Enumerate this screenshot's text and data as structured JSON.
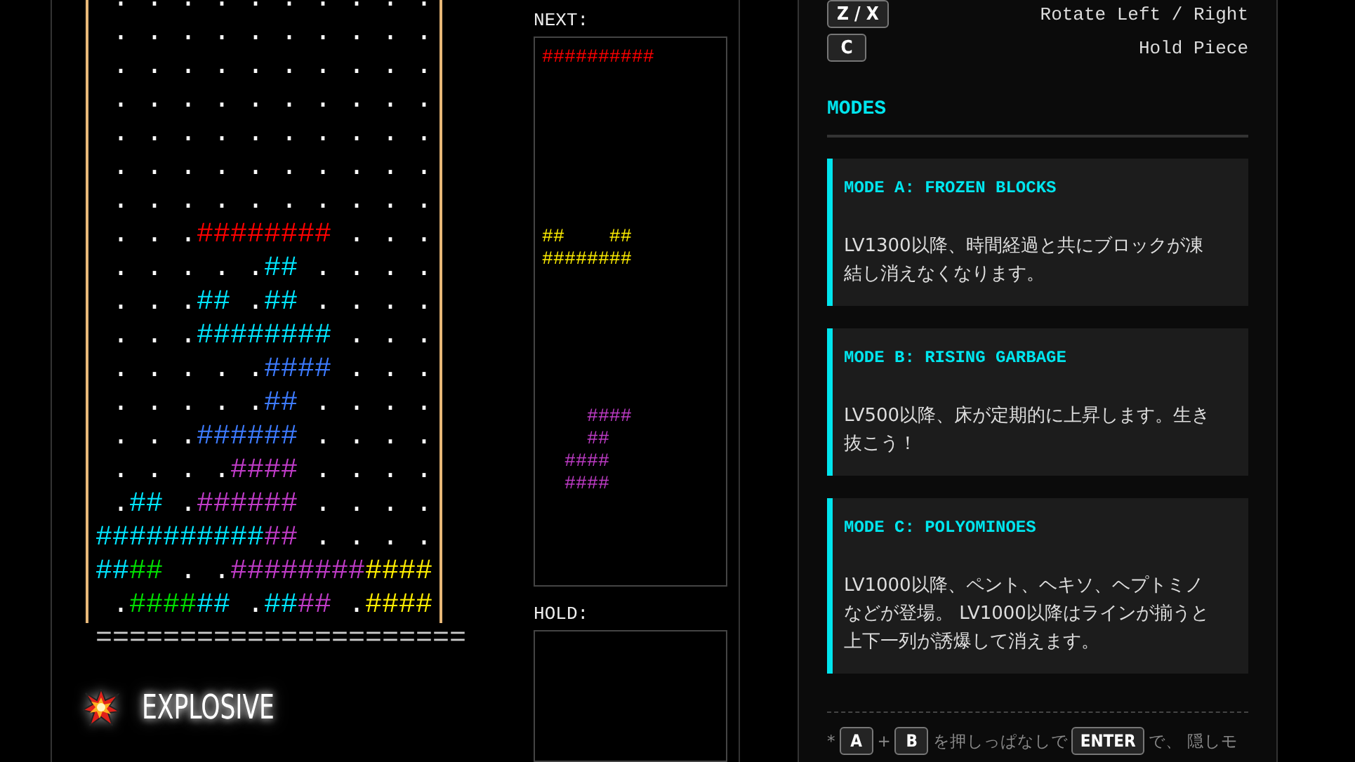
{
  "board": {
    "rows": [
      [
        {
          "kind": "empty",
          "text": " ."
        },
        {
          "kind": "empty",
          "text": " ."
        },
        {
          "kind": "empty",
          "text": " ."
        },
        {
          "kind": "empty",
          "text": " ."
        },
        {
          "kind": "empty",
          "text": " ."
        },
        {
          "kind": "empty",
          "text": " ."
        },
        {
          "kind": "empty",
          "text": " ."
        },
        {
          "kind": "empty",
          "text": " ."
        },
        {
          "kind": "empty",
          "text": " ."
        },
        {
          "kind": "empty",
          "text": " ."
        }
      ],
      [
        {
          "kind": "empty",
          "text": " ."
        },
        {
          "kind": "empty",
          "text": " ."
        },
        {
          "kind": "empty",
          "text": " ."
        },
        {
          "kind": "empty",
          "text": " ."
        },
        {
          "kind": "empty",
          "text": " ."
        },
        {
          "kind": "empty",
          "text": " ."
        },
        {
          "kind": "empty",
          "text": " ."
        },
        {
          "kind": "empty",
          "text": " ."
        },
        {
          "kind": "empty",
          "text": " ."
        },
        {
          "kind": "empty",
          "text": " ."
        }
      ],
      [
        {
          "kind": "empty",
          "text": " ."
        },
        {
          "kind": "empty",
          "text": " ."
        },
        {
          "kind": "empty",
          "text": " ."
        },
        {
          "kind": "empty",
          "text": " ."
        },
        {
          "kind": "empty",
          "text": " ."
        },
        {
          "kind": "empty",
          "text": " ."
        },
        {
          "kind": "empty",
          "text": " ."
        },
        {
          "kind": "empty",
          "text": " ."
        },
        {
          "kind": "empty",
          "text": " ."
        },
        {
          "kind": "empty",
          "text": " ."
        }
      ],
      [
        {
          "kind": "empty",
          "text": " ."
        },
        {
          "kind": "empty",
          "text": " ."
        },
        {
          "kind": "empty",
          "text": " ."
        },
        {
          "kind": "empty",
          "text": " ."
        },
        {
          "kind": "empty",
          "text": " ."
        },
        {
          "kind": "empty",
          "text": " ."
        },
        {
          "kind": "empty",
          "text": " ."
        },
        {
          "kind": "empty",
          "text": " ."
        },
        {
          "kind": "empty",
          "text": " ."
        },
        {
          "kind": "empty",
          "text": " ."
        }
      ],
      [
        {
          "kind": "empty",
          "text": " ."
        },
        {
          "kind": "empty",
          "text": " ."
        },
        {
          "kind": "empty",
          "text": " ."
        },
        {
          "kind": "empty",
          "text": " ."
        },
        {
          "kind": "empty",
          "text": " ."
        },
        {
          "kind": "empty",
          "text": " ."
        },
        {
          "kind": "empty",
          "text": " ."
        },
        {
          "kind": "empty",
          "text": " ."
        },
        {
          "kind": "empty",
          "text": " ."
        },
        {
          "kind": "empty",
          "text": " ."
        }
      ],
      [
        {
          "kind": "empty",
          "text": " ."
        },
        {
          "kind": "empty",
          "text": " ."
        },
        {
          "kind": "empty",
          "text": " ."
        },
        {
          "kind": "empty",
          "text": " ."
        },
        {
          "kind": "empty",
          "text": " ."
        },
        {
          "kind": "empty",
          "text": " ."
        },
        {
          "kind": "empty",
          "text": " ."
        },
        {
          "kind": "empty",
          "text": " ."
        },
        {
          "kind": "empty",
          "text": " ."
        },
        {
          "kind": "empty",
          "text": " ."
        }
      ],
      [
        {
          "kind": "empty",
          "text": " ."
        },
        {
          "kind": "empty",
          "text": " ."
        },
        {
          "kind": "empty",
          "text": " ."
        },
        {
          "kind": "empty",
          "text": " ."
        },
        {
          "kind": "empty",
          "text": " ."
        },
        {
          "kind": "empty",
          "text": " ."
        },
        {
          "kind": "empty",
          "text": " ."
        },
        {
          "kind": "empty",
          "text": " ."
        },
        {
          "kind": "empty",
          "text": " ."
        },
        {
          "kind": "empty",
          "text": " ."
        }
      ],
      [
        {
          "kind": "empty",
          "text": " ."
        },
        {
          "kind": "empty",
          "text": " ."
        },
        {
          "kind": "empty",
          "text": " ."
        },
        {
          "kind": "block",
          "text": "##",
          "color": "#ff0000"
        },
        {
          "kind": "block",
          "text": "##",
          "color": "#ff0000"
        },
        {
          "kind": "block",
          "text": "##",
          "color": "#ff0000"
        },
        {
          "kind": "block",
          "text": "##",
          "color": "#ff0000"
        },
        {
          "kind": "empty",
          "text": " ."
        },
        {
          "kind": "empty",
          "text": " ."
        },
        {
          "kind": "empty",
          "text": " ."
        }
      ],
      [
        {
          "kind": "empty",
          "text": " ."
        },
        {
          "kind": "empty",
          "text": " ."
        },
        {
          "kind": "empty",
          "text": " ."
        },
        {
          "kind": "empty",
          "text": " ."
        },
        {
          "kind": "empty",
          "text": " ."
        },
        {
          "kind": "block",
          "text": "##",
          "color": "#00e5ff"
        },
        {
          "kind": "empty",
          "text": " ."
        },
        {
          "kind": "empty",
          "text": " ."
        },
        {
          "kind": "empty",
          "text": " ."
        },
        {
          "kind": "empty",
          "text": " ."
        }
      ],
      [
        {
          "kind": "empty",
          "text": " ."
        },
        {
          "kind": "empty",
          "text": " ."
        },
        {
          "kind": "empty",
          "text": " ."
        },
        {
          "kind": "block",
          "text": "##",
          "color": "#00e5ff"
        },
        {
          "kind": "empty",
          "text": " ."
        },
        {
          "kind": "block",
          "text": "##",
          "color": "#00e5ff"
        },
        {
          "kind": "empty",
          "text": " ."
        },
        {
          "kind": "empty",
          "text": " ."
        },
        {
          "kind": "empty",
          "text": " ."
        },
        {
          "kind": "empty",
          "text": " ."
        }
      ],
      [
        {
          "kind": "empty",
          "text": " ."
        },
        {
          "kind": "empty",
          "text": " ."
        },
        {
          "kind": "empty",
          "text": " ."
        },
        {
          "kind": "block",
          "text": "##",
          "color": "#00e5ff"
        },
        {
          "kind": "block",
          "text": "##",
          "color": "#00e5ff"
        },
        {
          "kind": "block",
          "text": "##",
          "color": "#00e5ff"
        },
        {
          "kind": "block",
          "text": "##",
          "color": "#00e5ff"
        },
        {
          "kind": "empty",
          "text": " ."
        },
        {
          "kind": "empty",
          "text": " ."
        },
        {
          "kind": "empty",
          "text": " ."
        }
      ],
      [
        {
          "kind": "empty",
          "text": " ."
        },
        {
          "kind": "empty",
          "text": " ."
        },
        {
          "kind": "empty",
          "text": " ."
        },
        {
          "kind": "empty",
          "text": " ."
        },
        {
          "kind": "empty",
          "text": " ."
        },
        {
          "kind": "block",
          "text": "##",
          "color": "#3d7bff"
        },
        {
          "kind": "block",
          "text": "##",
          "color": "#3d7bff"
        },
        {
          "kind": "empty",
          "text": " ."
        },
        {
          "kind": "empty",
          "text": " ."
        },
        {
          "kind": "empty",
          "text": " ."
        }
      ],
      [
        {
          "kind": "empty",
          "text": " ."
        },
        {
          "kind": "empty",
          "text": " ."
        },
        {
          "kind": "empty",
          "text": " ."
        },
        {
          "kind": "empty",
          "text": " ."
        },
        {
          "kind": "empty",
          "text": " ."
        },
        {
          "kind": "block",
          "text": "##",
          "color": "#3d7bff"
        },
        {
          "kind": "empty",
          "text": " ."
        },
        {
          "kind": "empty",
          "text": " ."
        },
        {
          "kind": "empty",
          "text": " ."
        },
        {
          "kind": "empty",
          "text": " ."
        }
      ],
      [
        {
          "kind": "empty",
          "text": " ."
        },
        {
          "kind": "empty",
          "text": " ."
        },
        {
          "kind": "empty",
          "text": " ."
        },
        {
          "kind": "block",
          "text": "##",
          "color": "#3d7bff"
        },
        {
          "kind": "block",
          "text": "##",
          "color": "#3d7bff"
        },
        {
          "kind": "block",
          "text": "##",
          "color": "#3d7bff"
        },
        {
          "kind": "empty",
          "text": " ."
        },
        {
          "kind": "empty",
          "text": " ."
        },
        {
          "kind": "empty",
          "text": " ."
        },
        {
          "kind": "empty",
          "text": " ."
        }
      ],
      [
        {
          "kind": "empty",
          "text": " ."
        },
        {
          "kind": "empty",
          "text": " ."
        },
        {
          "kind": "empty",
          "text": " ."
        },
        {
          "kind": "empty",
          "text": " ."
        },
        {
          "kind": "block",
          "text": "##",
          "color": "#c03cc8"
        },
        {
          "kind": "block",
          "text": "##",
          "color": "#c03cc8"
        },
        {
          "kind": "empty",
          "text": " ."
        },
        {
          "kind": "empty",
          "text": " ."
        },
        {
          "kind": "empty",
          "text": " ."
        },
        {
          "kind": "empty",
          "text": " ."
        }
      ],
      [
        {
          "kind": "empty",
          "text": " ."
        },
        {
          "kind": "block",
          "text": "##",
          "color": "#00e5ff"
        },
        {
          "kind": "empty",
          "text": " ."
        },
        {
          "kind": "block",
          "text": "##",
          "color": "#c03cc8"
        },
        {
          "kind": "block",
          "text": "##",
          "color": "#c03cc8"
        },
        {
          "kind": "block",
          "text": "##",
          "color": "#c03cc8"
        },
        {
          "kind": "empty",
          "text": " ."
        },
        {
          "kind": "empty",
          "text": " ."
        },
        {
          "kind": "empty",
          "text": " ."
        },
        {
          "kind": "empty",
          "text": " ."
        }
      ],
      [
        {
          "kind": "block",
          "text": "##",
          "color": "#00e5ff"
        },
        {
          "kind": "block",
          "text": "##",
          "color": "#00e5ff"
        },
        {
          "kind": "block",
          "text": "##",
          "color": "#00e5ff"
        },
        {
          "kind": "block",
          "text": "##",
          "color": "#00e5ff"
        },
        {
          "kind": "block",
          "text": "##",
          "color": "#00e5ff"
        },
        {
          "kind": "block",
          "text": "##",
          "color": "#c03cc8"
        },
        {
          "kind": "empty",
          "text": " ."
        },
        {
          "kind": "empty",
          "text": " ."
        },
        {
          "kind": "empty",
          "text": " ."
        },
        {
          "kind": "empty",
          "text": " ."
        }
      ],
      [
        {
          "kind": "block",
          "text": "##",
          "color": "#00e5ff"
        },
        {
          "kind": "block",
          "text": "##",
          "color": "#00e000"
        },
        {
          "kind": "empty",
          "text": " ."
        },
        {
          "kind": "empty",
          "text": " ."
        },
        {
          "kind": "block",
          "text": "##",
          "color": "#c03cc8"
        },
        {
          "kind": "block",
          "text": "##",
          "color": "#c03cc8"
        },
        {
          "kind": "block",
          "text": "##",
          "color": "#c03cc8"
        },
        {
          "kind": "block",
          "text": "##",
          "color": "#c03cc8"
        },
        {
          "kind": "block",
          "text": "##",
          "color": "#ffee00"
        },
        {
          "kind": "block",
          "text": "##",
          "color": "#ffee00"
        }
      ],
      [
        {
          "kind": "empty",
          "text": " ."
        },
        {
          "kind": "block",
          "text": "##",
          "color": "#00e000"
        },
        {
          "kind": "block",
          "text": "##",
          "color": "#00e000"
        },
        {
          "kind": "block",
          "text": "##",
          "color": "#00e5ff"
        },
        {
          "kind": "empty",
          "text": " ."
        },
        {
          "kind": "block",
          "text": "##",
          "color": "#00e5ff"
        },
        {
          "kind": "block",
          "text": "##",
          "color": "#c03cc8"
        },
        {
          "kind": "empty",
          "text": " ."
        },
        {
          "kind": "block",
          "text": "##",
          "color": "#ffee00"
        },
        {
          "kind": "block",
          "text": "##",
          "color": "#ffee00"
        }
      ]
    ],
    "floor": "======================"
  },
  "status": {
    "label": "EXPLOSIVE"
  },
  "next": {
    "label": "NEXT:",
    "pieces": [
      {
        "lines": [
          "##########"
        ],
        "color": "#ff0000"
      },
      {
        "lines": [
          "##    ##",
          "########"
        ],
        "color": "#ffee00"
      },
      {
        "lines": [
          "    ####",
          "    ##",
          "  ####",
          "  ####"
        ],
        "color": "#c03cc8"
      }
    ]
  },
  "hold": {
    "label": "HOLD:"
  },
  "controls": [
    {
      "key": "Z / X",
      "action": "Rotate Left / Right"
    },
    {
      "key": "C",
      "action": "Hold Piece"
    }
  ],
  "modes": {
    "heading": "MODES",
    "items": [
      {
        "title": "MODE A: FROZEN BLOCKS",
        "description": "LV1300以降、時間経過と共にブロックが凍結し消えなくなります。"
      },
      {
        "title": "MODE B: RISING GARBAGE",
        "description": "LV500以降、床が定期的に上昇します。生き抜こう！"
      },
      {
        "title": "MODE C: POLYOMINOES",
        "description": "LV1000以降、ペント、ヘキソ、ヘプトミノなどが登場。 LV1000以降はラインが揃うと上下一列が誘爆して消えます。"
      }
    ]
  },
  "footer": [
    {
      "kind": "text",
      "text": "*"
    },
    {
      "kind": "key",
      "text": "A"
    },
    {
      "kind": "text",
      "text": "+"
    },
    {
      "kind": "key",
      "text": "B"
    },
    {
      "kind": "text",
      "text": "を押しっぱなしで"
    },
    {
      "kind": "key",
      "text": "ENTER"
    },
    {
      "kind": "text",
      "text": "で、 隠しモ"
    }
  ]
}
